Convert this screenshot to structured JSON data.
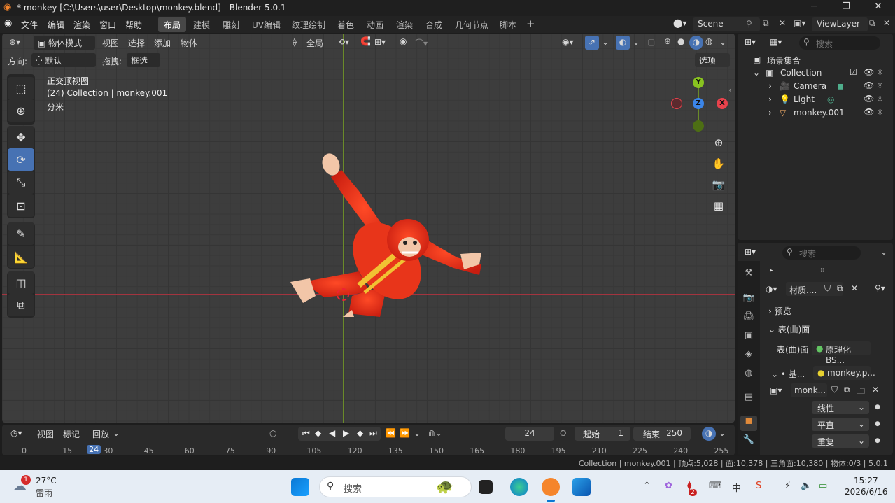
{
  "window": {
    "title": "* monkey [C:\\Users\\user\\Desktop\\monkey.blend] - Blender 5.0.1",
    "minimize": "─",
    "maximize": "❐",
    "close": "✕"
  },
  "menu": {
    "file": "文件",
    "edit": "编辑",
    "render": "渲染",
    "window": "窗口",
    "help": "帮助"
  },
  "workspaces": [
    "布局",
    "建模",
    "雕刻",
    "UV编辑",
    "纹理绘制",
    "着色",
    "动画",
    "渲染",
    "合成",
    "几何节点",
    "脚本"
  ],
  "scene": {
    "name": "Scene",
    "view_layer": "ViewLayer"
  },
  "viewport": {
    "mode": "物体模式",
    "menus": [
      "视图",
      "选择",
      "添加",
      "物体"
    ],
    "orientation": "全局",
    "direction_label": "方向:",
    "direction_value": "默认",
    "drag_label": "拖拽:",
    "drag_value": "框选",
    "options": "选项",
    "overlay_view": "正交顶视图",
    "overlay_collection": "(24) Collection | monkey.001",
    "overlay_units": "分米",
    "gizmo": {
      "x": "X",
      "y": "Y",
      "z": "Z"
    }
  },
  "timeline": {
    "menus": [
      "视图",
      "标记"
    ],
    "playback": "回放",
    "current_frame": "24",
    "start_label": "起始",
    "start_value": "1",
    "end_label": "结束",
    "end_value": "250",
    "ticks": [
      "0",
      "15",
      "24",
      "30",
      "45",
      "60",
      "75",
      "90",
      "105",
      "120",
      "135",
      "150",
      "165",
      "180",
      "195",
      "210",
      "225",
      "240",
      "255"
    ]
  },
  "status": "Collection | monkey.001 | 顶点:5,028 | 面:10,378 | 三角面:10,380 | 物体:0/3 | 5.0.1",
  "outliner": {
    "search_placeholder": "搜索",
    "root": "场景集合",
    "collection": "Collection",
    "items": [
      "Camera",
      "Light",
      "monkey.001"
    ]
  },
  "properties": {
    "search_placeholder": "搜索",
    "material_name": "材质....",
    "preview": "预览",
    "surface_panel": "表(曲)面",
    "surface_label": "表(曲)面",
    "surface_value": "原理化 BS...",
    "base_label": "基...",
    "base_value": "monkey.p...",
    "image_name": "monk...",
    "interp": "线性",
    "projection": "平直",
    "extension": "重复"
  },
  "taskbar": {
    "weather_temp": "27°C",
    "weather_desc": "雷雨",
    "weather_badge": "1",
    "search_placeholder": "搜索",
    "time": "15:27",
    "date": "2026/6/16",
    "tray_badge": "2",
    "ime": "中"
  },
  "colors": {
    "accent": "#4772b3",
    "axis_x": "#e8424c",
    "axis_y": "#89c320",
    "axis_z": "#3b85e8"
  }
}
